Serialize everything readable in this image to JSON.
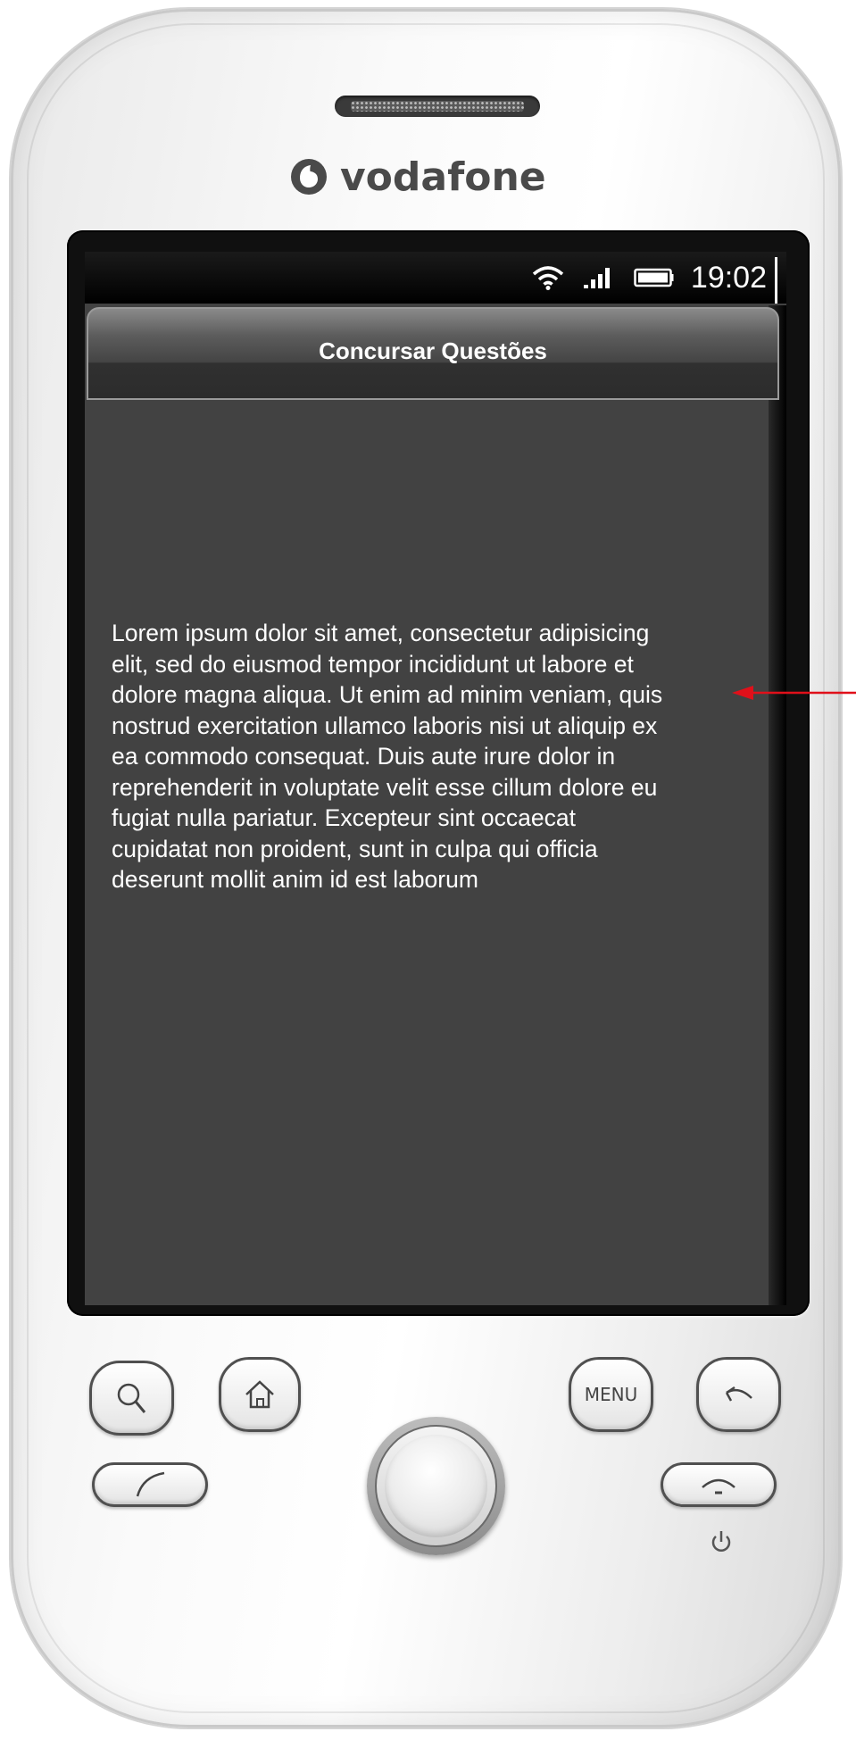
{
  "device": {
    "brand": "vodafone",
    "icons": {
      "brand_mark": "vodafone-logo-icon",
      "search": "search-icon",
      "home": "home-icon",
      "back": "back-arrow-icon",
      "call": "call-icon",
      "end_call": "end-call-icon",
      "power": "power-icon",
      "trackball": "trackball-icon"
    },
    "buttons": {
      "menu_label": "MENU"
    },
    "colors": {
      "screen_bg": "#424242",
      "brand_text": "#4a4a4a",
      "arrow": "#e0101a"
    }
  },
  "status_bar": {
    "time": "19:02",
    "icons": [
      "wifi-icon",
      "signal-icon",
      "battery-icon"
    ]
  },
  "app": {
    "title": "Concursar Questões",
    "body_lines": [
      "Lorem ipsum dolor sit amet, consectetur adipisicing",
      "elit, sed do eiusmod tempor incididunt ut labore et",
      "dolore magna aliqua. Ut enim ad minim veniam, quis",
      "nostrud exercitation ullamco laboris nisi ut aliquip ex",
      "ea commodo consequat. Duis aute irure dolor in",
      "reprehenderit in voluptate velit esse cillum dolore eu",
      "fugiat nulla pariatur. Excepteur sint occaecat",
      "cupidatat non proident, sunt in culpa qui officia",
      "deserunt mollit anim id est laborum"
    ]
  }
}
